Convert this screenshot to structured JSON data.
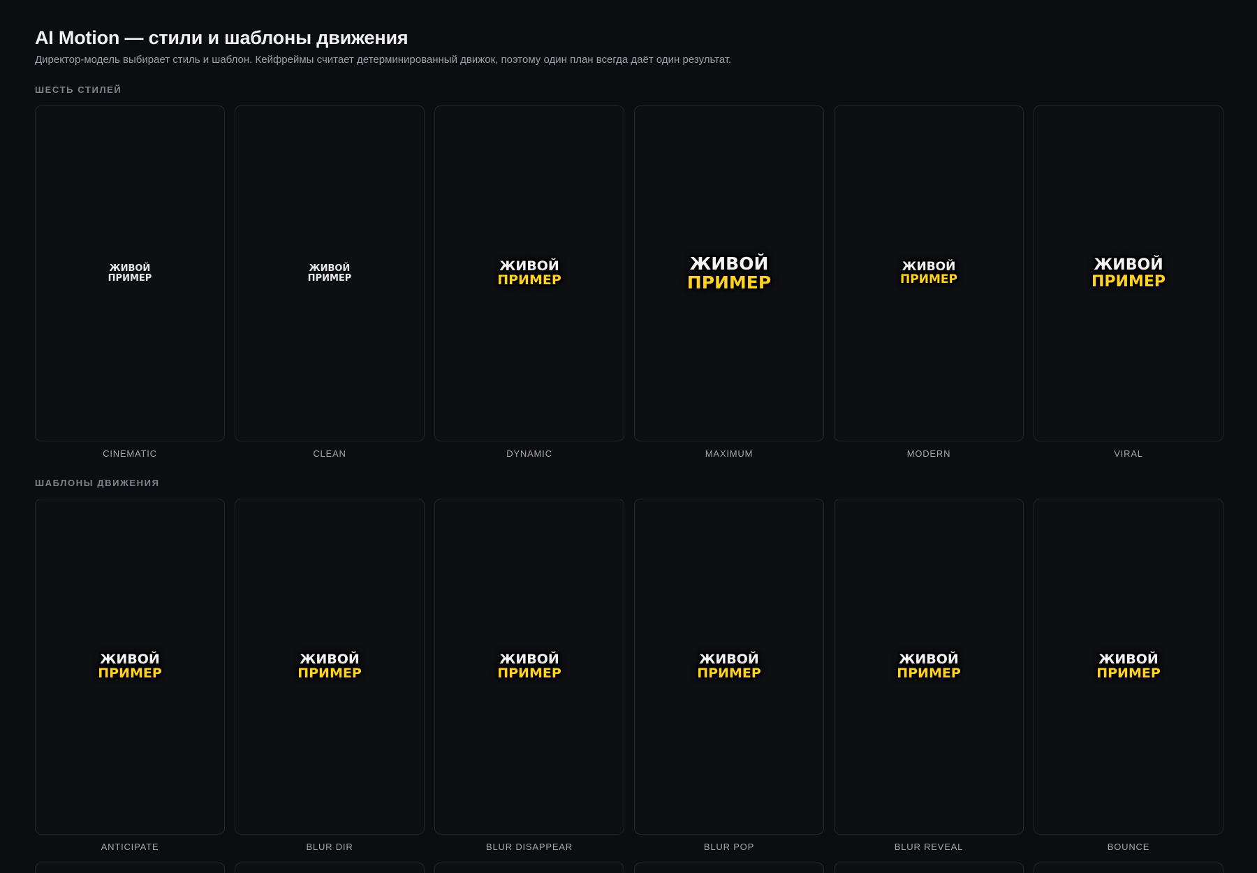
{
  "header": {
    "title": "AI Motion — стили и шаблоны движения",
    "subtitle": "Директор-модель выбирает стиль и шаблон. Кейфреймы считает детерминированный движок, поэтому один план всегда даёт один результат."
  },
  "sample_text": {
    "line1": "ЖИВОЙ",
    "line2": "ПРИМЕР"
  },
  "colors": {
    "background": "#0b0d11",
    "card_border": "#23262d",
    "accent_yellow": "#ffd21f",
    "text_white": "#f4f4f4"
  },
  "styles_section": {
    "label": "ШЕСТЬ СТИЛЕЙ",
    "items": [
      {
        "caption": "CINEMATIC"
      },
      {
        "caption": "CLEAN"
      },
      {
        "caption": "DYNAMIC"
      },
      {
        "caption": "MAXIMUM"
      },
      {
        "caption": "MODERN"
      },
      {
        "caption": "VIRAL"
      }
    ]
  },
  "motion_section": {
    "label": "ШАБЛОНЫ ДВИЖЕНИЯ",
    "items": [
      {
        "caption": "ANTICIPATE"
      },
      {
        "caption": "BLUR DIR"
      },
      {
        "caption": "BLUR DISAPPEAR"
      },
      {
        "caption": "BLUR POP"
      },
      {
        "caption": "BLUR REVEAL"
      },
      {
        "caption": "BOUNCE"
      }
    ]
  }
}
